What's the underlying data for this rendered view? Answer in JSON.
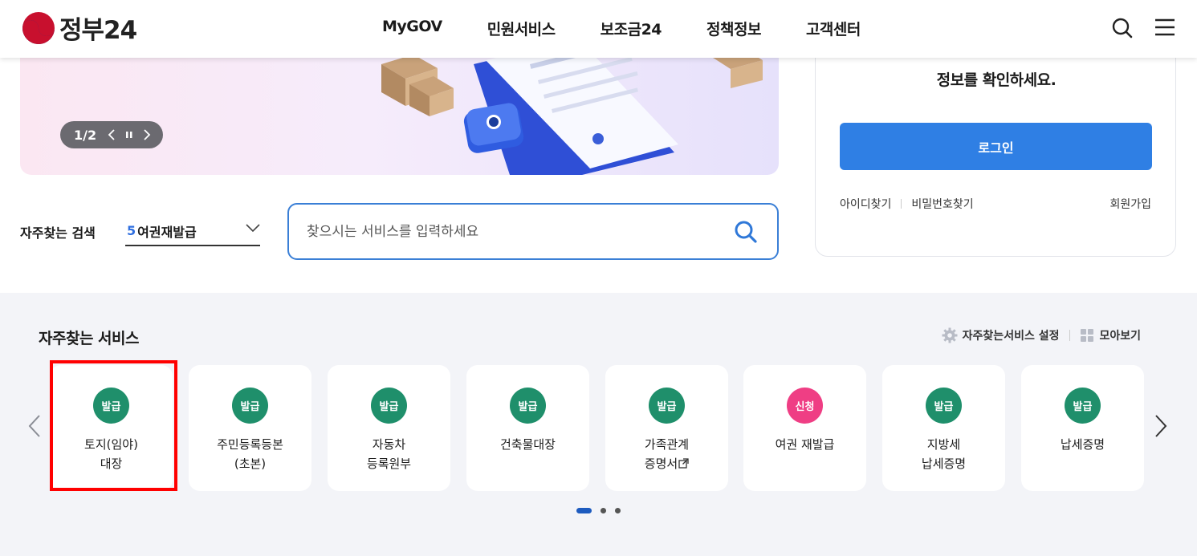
{
  "header": {
    "logo_text": "정부24",
    "nav": [
      "MyGOV",
      "민원서비스",
      "보조금24",
      "정책정보",
      "고객센터"
    ]
  },
  "banner": {
    "pager": "1/2"
  },
  "login": {
    "info_text": "정보를 확인하세요.",
    "button": "로그인",
    "find_id": "아이디찾기",
    "find_pw": "비밀번호찾기",
    "signup": "회원가입"
  },
  "search": {
    "fav_label": "자주찾는 검색",
    "fav_rank": "5",
    "fav_value": "여권재발급",
    "placeholder": "찾으시는 서비스를 입력하세요"
  },
  "services": {
    "title": "자주찾는 서비스",
    "settings": "자주찾는서비스 설정",
    "view_all": "모아보기",
    "colors": {
      "issue": "#1f8f6b",
      "apply": "#ef3e84"
    },
    "items": [
      {
        "badge": "발급",
        "line1": "토지(임야)",
        "line2": "대장"
      },
      {
        "badge": "발급",
        "line1": "주민등록등본",
        "line2": "(초본)"
      },
      {
        "badge": "발급",
        "line1": "자동차",
        "line2": "등록원부"
      },
      {
        "badge": "발급",
        "line1": "건축물대장",
        "line2": ""
      },
      {
        "badge": "발급",
        "line1": "가족관계",
        "line2": "증명서"
      },
      {
        "badge": "신청",
        "line1": "여권 재발급",
        "line2": ""
      },
      {
        "badge": "발급",
        "line1": "지방세",
        "line2": "납세증명"
      },
      {
        "badge": "발급",
        "line1": "납세증명",
        "line2": ""
      }
    ]
  }
}
